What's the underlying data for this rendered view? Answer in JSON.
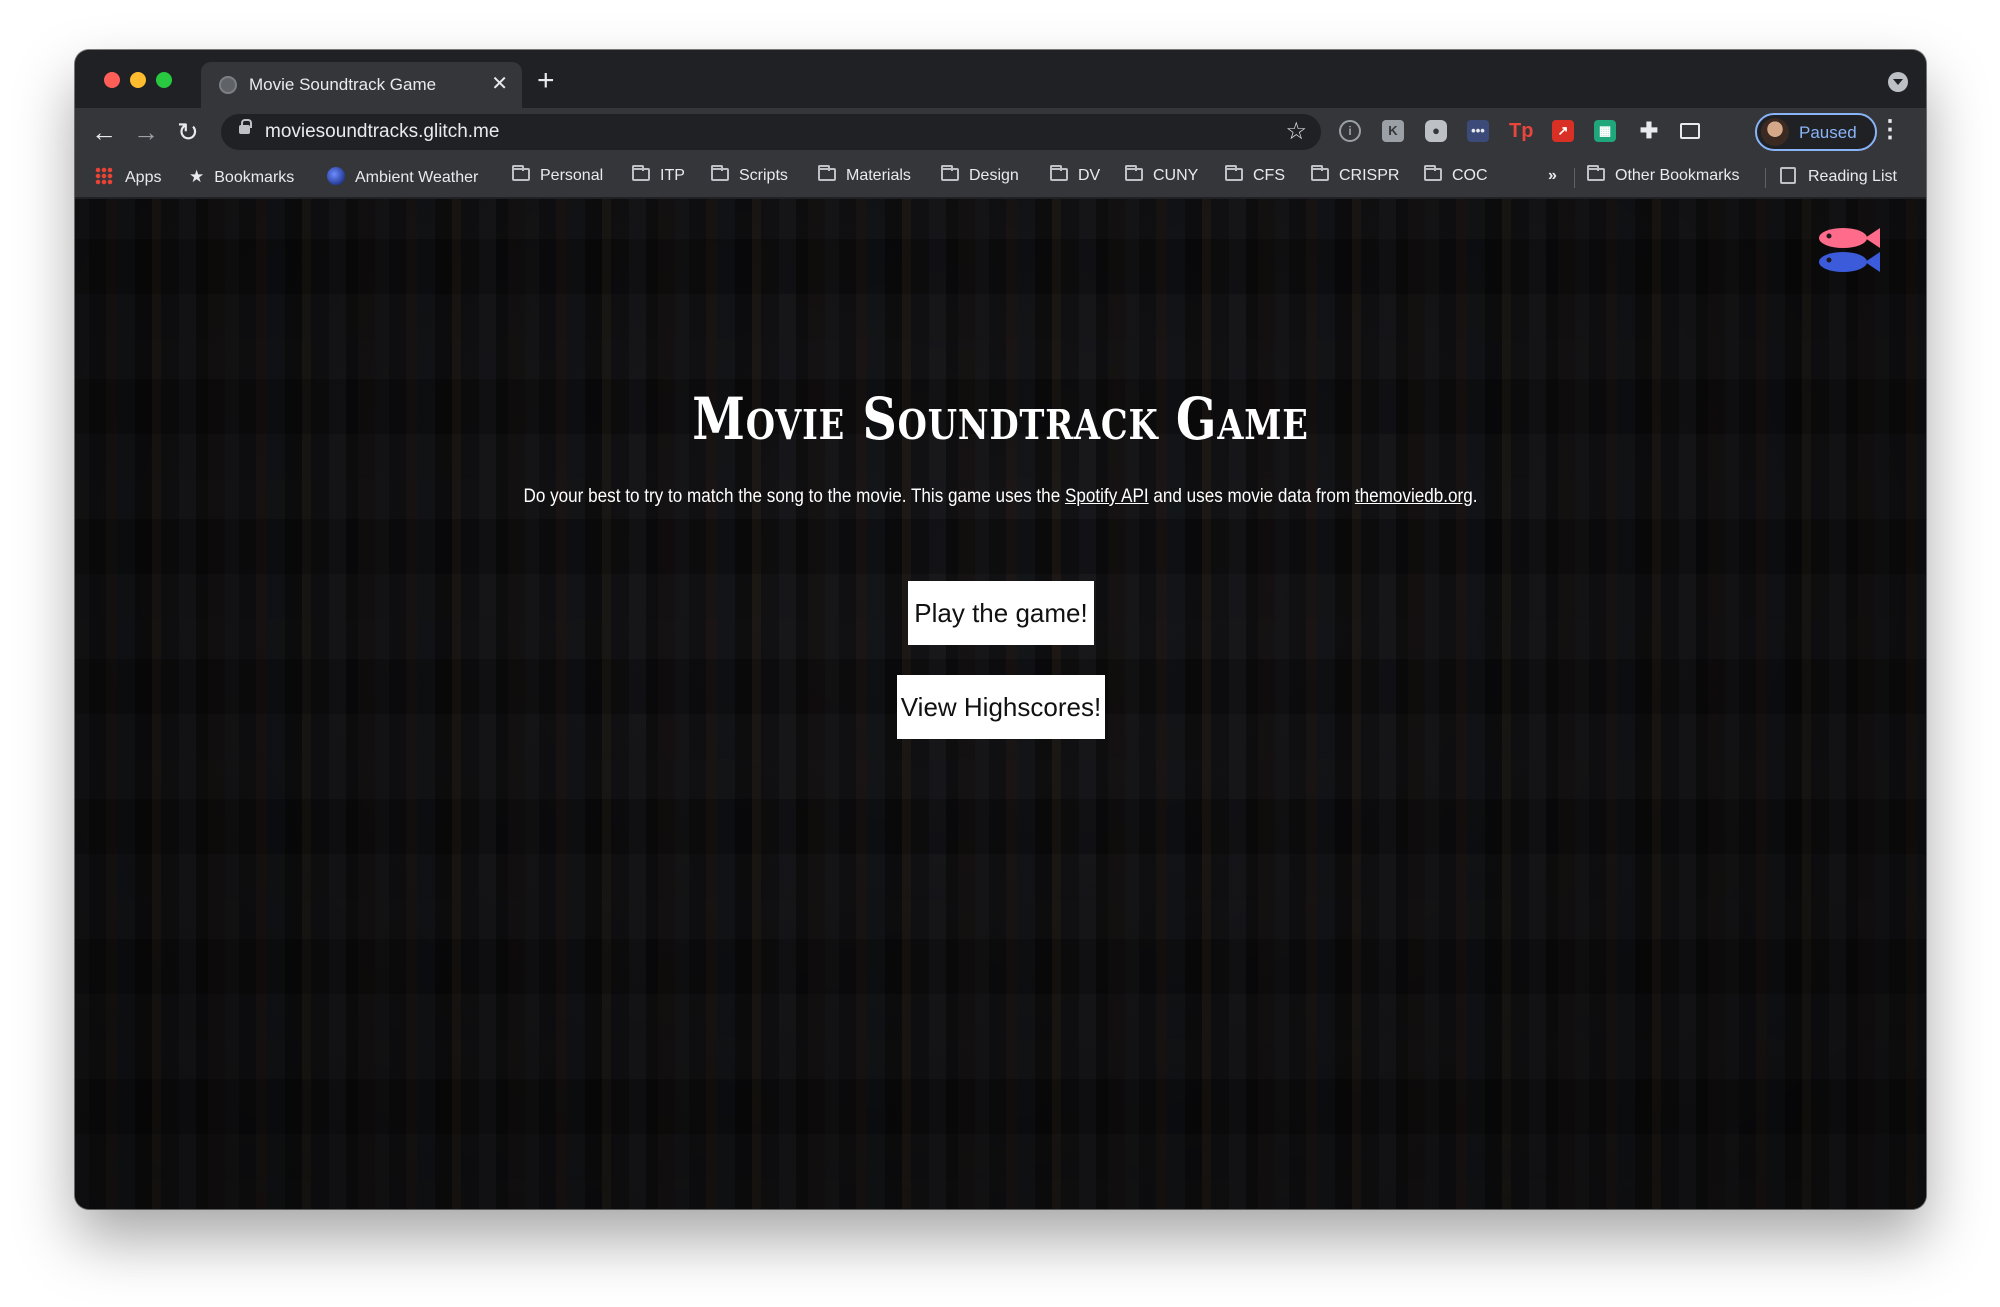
{
  "browser": {
    "tab_title": "Movie Soundtrack Game",
    "tab_close": "✕",
    "new_tab": "+",
    "url": "moviesoundtracks.glitch.me",
    "profile_label": "Paused",
    "nav": {
      "back": "←",
      "forward": "→",
      "reload": "↻",
      "star": "☆",
      "menu": "⋮"
    }
  },
  "bookmarks": {
    "items": [
      {
        "label": "Apps",
        "icon": "apps-grid-icon"
      },
      {
        "label": "Bookmarks",
        "icon": "star-icon"
      },
      {
        "label": "Ambient Weather",
        "icon": "globe-icon"
      },
      {
        "label": "Personal",
        "icon": "folder-icon"
      },
      {
        "label": "ITP",
        "icon": "folder-icon"
      },
      {
        "label": "Scripts",
        "icon": "folder-icon"
      },
      {
        "label": "Materials",
        "icon": "folder-icon"
      },
      {
        "label": "Design",
        "icon": "folder-icon"
      },
      {
        "label": "DV",
        "icon": "folder-icon"
      },
      {
        "label": "CUNY",
        "icon": "folder-icon"
      },
      {
        "label": "CFS",
        "icon": "folder-icon"
      },
      {
        "label": "CRISPR",
        "icon": "folder-icon"
      },
      {
        "label": "COC",
        "icon": "folder-icon"
      }
    ],
    "overflow": "»",
    "other": "Other Bookmarks",
    "reading_list": "Reading List"
  },
  "page": {
    "title": "Movie Soundtrack Game",
    "desc_before": "Do your best to try to match the song to the movie. This game uses the ",
    "link_spotify": "Spotify API",
    "desc_middle": " and uses movie data from ",
    "link_tmdb": "themoviedb.org",
    "desc_end": ".",
    "play_button": "Play the game!",
    "highscores_button": "View Highscores!"
  },
  "colors": {
    "chrome_dark": "#202124",
    "toolbar": "#35363a",
    "profile_accent": "#8ab4f8",
    "page_bg": "#0d0d0f",
    "button_bg": "#ffffff"
  }
}
